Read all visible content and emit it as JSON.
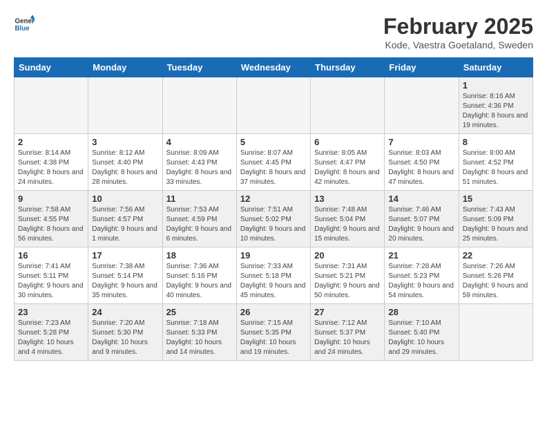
{
  "header": {
    "logo_line1": "General",
    "logo_line2": "Blue",
    "month": "February 2025",
    "location": "Kode, Vaestra Goetaland, Sweden"
  },
  "days_of_week": [
    "Sunday",
    "Monday",
    "Tuesday",
    "Wednesday",
    "Thursday",
    "Friday",
    "Saturday"
  ],
  "weeks": [
    [
      {
        "num": "",
        "info": "",
        "empty": true
      },
      {
        "num": "",
        "info": "",
        "empty": true
      },
      {
        "num": "",
        "info": "",
        "empty": true
      },
      {
        "num": "",
        "info": "",
        "empty": true
      },
      {
        "num": "",
        "info": "",
        "empty": true
      },
      {
        "num": "",
        "info": "",
        "empty": true
      },
      {
        "num": "1",
        "info": "Sunrise: 8:16 AM\nSunset: 4:36 PM\nDaylight: 8 hours and 19 minutes.",
        "empty": false
      }
    ],
    [
      {
        "num": "2",
        "info": "Sunrise: 8:14 AM\nSunset: 4:38 PM\nDaylight: 8 hours and 24 minutes.",
        "empty": false
      },
      {
        "num": "3",
        "info": "Sunrise: 8:12 AM\nSunset: 4:40 PM\nDaylight: 8 hours and 28 minutes.",
        "empty": false
      },
      {
        "num": "4",
        "info": "Sunrise: 8:09 AM\nSunset: 4:43 PM\nDaylight: 8 hours and 33 minutes.",
        "empty": false
      },
      {
        "num": "5",
        "info": "Sunrise: 8:07 AM\nSunset: 4:45 PM\nDaylight: 8 hours and 37 minutes.",
        "empty": false
      },
      {
        "num": "6",
        "info": "Sunrise: 8:05 AM\nSunset: 4:47 PM\nDaylight: 8 hours and 42 minutes.",
        "empty": false
      },
      {
        "num": "7",
        "info": "Sunrise: 8:03 AM\nSunset: 4:50 PM\nDaylight: 8 hours and 47 minutes.",
        "empty": false
      },
      {
        "num": "8",
        "info": "Sunrise: 8:00 AM\nSunset: 4:52 PM\nDaylight: 8 hours and 51 minutes.",
        "empty": false
      }
    ],
    [
      {
        "num": "9",
        "info": "Sunrise: 7:58 AM\nSunset: 4:55 PM\nDaylight: 8 hours and 56 minutes.",
        "empty": false
      },
      {
        "num": "10",
        "info": "Sunrise: 7:56 AM\nSunset: 4:57 PM\nDaylight: 9 hours and 1 minute.",
        "empty": false
      },
      {
        "num": "11",
        "info": "Sunrise: 7:53 AM\nSunset: 4:59 PM\nDaylight: 9 hours and 6 minutes.",
        "empty": false
      },
      {
        "num": "12",
        "info": "Sunrise: 7:51 AM\nSunset: 5:02 PM\nDaylight: 9 hours and 10 minutes.",
        "empty": false
      },
      {
        "num": "13",
        "info": "Sunrise: 7:48 AM\nSunset: 5:04 PM\nDaylight: 9 hours and 15 minutes.",
        "empty": false
      },
      {
        "num": "14",
        "info": "Sunrise: 7:46 AM\nSunset: 5:07 PM\nDaylight: 9 hours and 20 minutes.",
        "empty": false
      },
      {
        "num": "15",
        "info": "Sunrise: 7:43 AM\nSunset: 5:09 PM\nDaylight: 9 hours and 25 minutes.",
        "empty": false
      }
    ],
    [
      {
        "num": "16",
        "info": "Sunrise: 7:41 AM\nSunset: 5:11 PM\nDaylight: 9 hours and 30 minutes.",
        "empty": false
      },
      {
        "num": "17",
        "info": "Sunrise: 7:38 AM\nSunset: 5:14 PM\nDaylight: 9 hours and 35 minutes.",
        "empty": false
      },
      {
        "num": "18",
        "info": "Sunrise: 7:36 AM\nSunset: 5:16 PM\nDaylight: 9 hours and 40 minutes.",
        "empty": false
      },
      {
        "num": "19",
        "info": "Sunrise: 7:33 AM\nSunset: 5:18 PM\nDaylight: 9 hours and 45 minutes.",
        "empty": false
      },
      {
        "num": "20",
        "info": "Sunrise: 7:31 AM\nSunset: 5:21 PM\nDaylight: 9 hours and 50 minutes.",
        "empty": false
      },
      {
        "num": "21",
        "info": "Sunrise: 7:28 AM\nSunset: 5:23 PM\nDaylight: 9 hours and 54 minutes.",
        "empty": false
      },
      {
        "num": "22",
        "info": "Sunrise: 7:26 AM\nSunset: 5:26 PM\nDaylight: 9 hours and 59 minutes.",
        "empty": false
      }
    ],
    [
      {
        "num": "23",
        "info": "Sunrise: 7:23 AM\nSunset: 5:28 PM\nDaylight: 10 hours and 4 minutes.",
        "empty": false
      },
      {
        "num": "24",
        "info": "Sunrise: 7:20 AM\nSunset: 5:30 PM\nDaylight: 10 hours and 9 minutes.",
        "empty": false
      },
      {
        "num": "25",
        "info": "Sunrise: 7:18 AM\nSunset: 5:33 PM\nDaylight: 10 hours and 14 minutes.",
        "empty": false
      },
      {
        "num": "26",
        "info": "Sunrise: 7:15 AM\nSunset: 5:35 PM\nDaylight: 10 hours and 19 minutes.",
        "empty": false
      },
      {
        "num": "27",
        "info": "Sunrise: 7:12 AM\nSunset: 5:37 PM\nDaylight: 10 hours and 24 minutes.",
        "empty": false
      },
      {
        "num": "28",
        "info": "Sunrise: 7:10 AM\nSunset: 5:40 PM\nDaylight: 10 hours and 29 minutes.",
        "empty": false
      },
      {
        "num": "",
        "info": "",
        "empty": true
      }
    ]
  ]
}
